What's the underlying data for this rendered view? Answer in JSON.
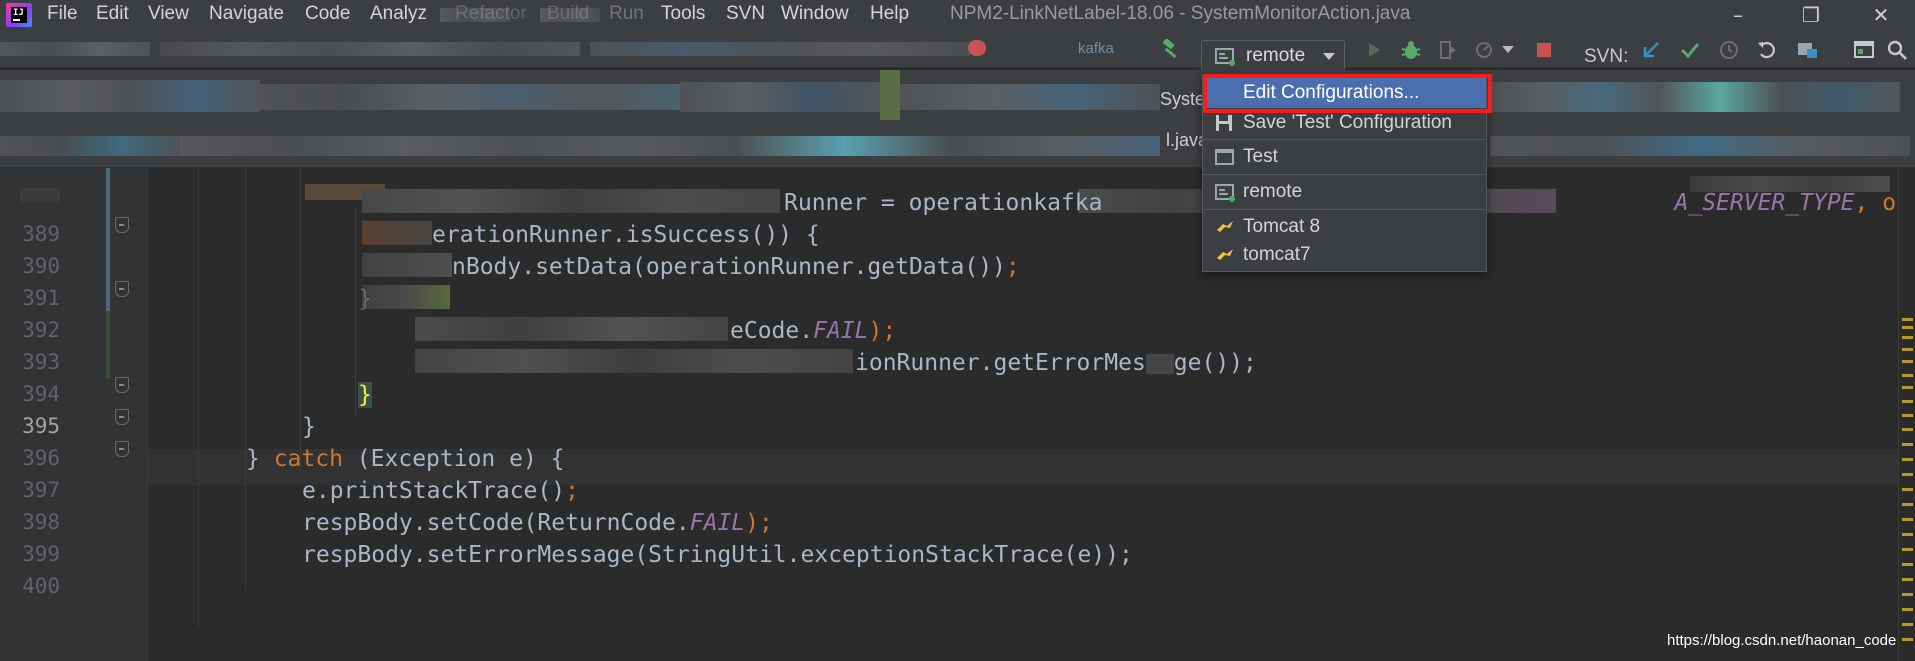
{
  "menu": {
    "items": [
      "File",
      "Edit",
      "View",
      "Navigate",
      "Code",
      "Analyz",
      "Refactor",
      "Build",
      "Run",
      "Tools",
      "SVN",
      "Window",
      "Help"
    ],
    "window_title": "NPM2-LinkNetLabel-18.06 - SystemMonitorAction.java"
  },
  "toolbar": {
    "breadcrumb_stub": "kafka",
    "run_config": "remote",
    "svn_label": "SVN:"
  },
  "tabs": {
    "stub_top": "Syste",
    "stub_bottom": "l.java"
  },
  "popup": {
    "items": [
      {
        "label": "Edit Configurations...",
        "icon": "edit-config-icon",
        "selected": true
      },
      {
        "label": "Save 'Test' Configuration",
        "icon": "save-icon",
        "selected": false
      },
      {
        "label": "Test",
        "icon": "test-config-icon",
        "selected": false
      },
      {
        "label": "remote",
        "icon": "remote-config-icon",
        "selected": false
      },
      {
        "label": "Tomcat 8",
        "icon": "tomcat-icon",
        "selected": false
      },
      {
        "label": "tomcat7",
        "icon": "tomcat-icon",
        "selected": false
      }
    ]
  },
  "editor": {
    "current_line": "395",
    "lines": [
      {
        "num": "389",
        "segments": [
          "Runner = operationkafka",
          "A_SERVER_TYPE",
          ", opera"
        ]
      },
      {
        "num": "390",
        "segments": [
          "erationRunner.isSuccess()) {"
        ]
      },
      {
        "num": "391",
        "segments": [
          "nBody.setData(operationRunner.getData())",
          ";"
        ]
      },
      {
        "num": "392",
        "segments": [
          "}"
        ]
      },
      {
        "num": "393",
        "segments": [
          "eCode.",
          "FAIL",
          ");"
        ]
      },
      {
        "num": "394",
        "segments": [
          "ionRunner.getErrorMes",
          "ge());"
        ]
      },
      {
        "num": "395",
        "segments": [
          "}"
        ]
      },
      {
        "num": "396",
        "segments": [
          "}"
        ]
      },
      {
        "num": "397",
        "segments": [
          "} ",
          "catch",
          " (Exception e) {"
        ]
      },
      {
        "num": "398",
        "segments": [
          "e.printStackTrace()",
          ";"
        ]
      },
      {
        "num": "399",
        "segments": [
          "respBody.setCode(ReturnCode.",
          "FAIL",
          ");"
        ]
      },
      {
        "num": "400",
        "segments": [
          "respBody.setErrorMessage(StringUtil.exceptionStackTrace(e));"
        ]
      }
    ]
  },
  "watermark": "https://blog.csdn.net/haonan_code",
  "colors": {
    "editor_bg": "#2b2b2b",
    "chrome_bg": "#3c3f41",
    "keyword": "#cc7832",
    "constant": "#9876aa",
    "selection": "#4b6eaf",
    "highlight_frame": "#ff1a1a"
  }
}
